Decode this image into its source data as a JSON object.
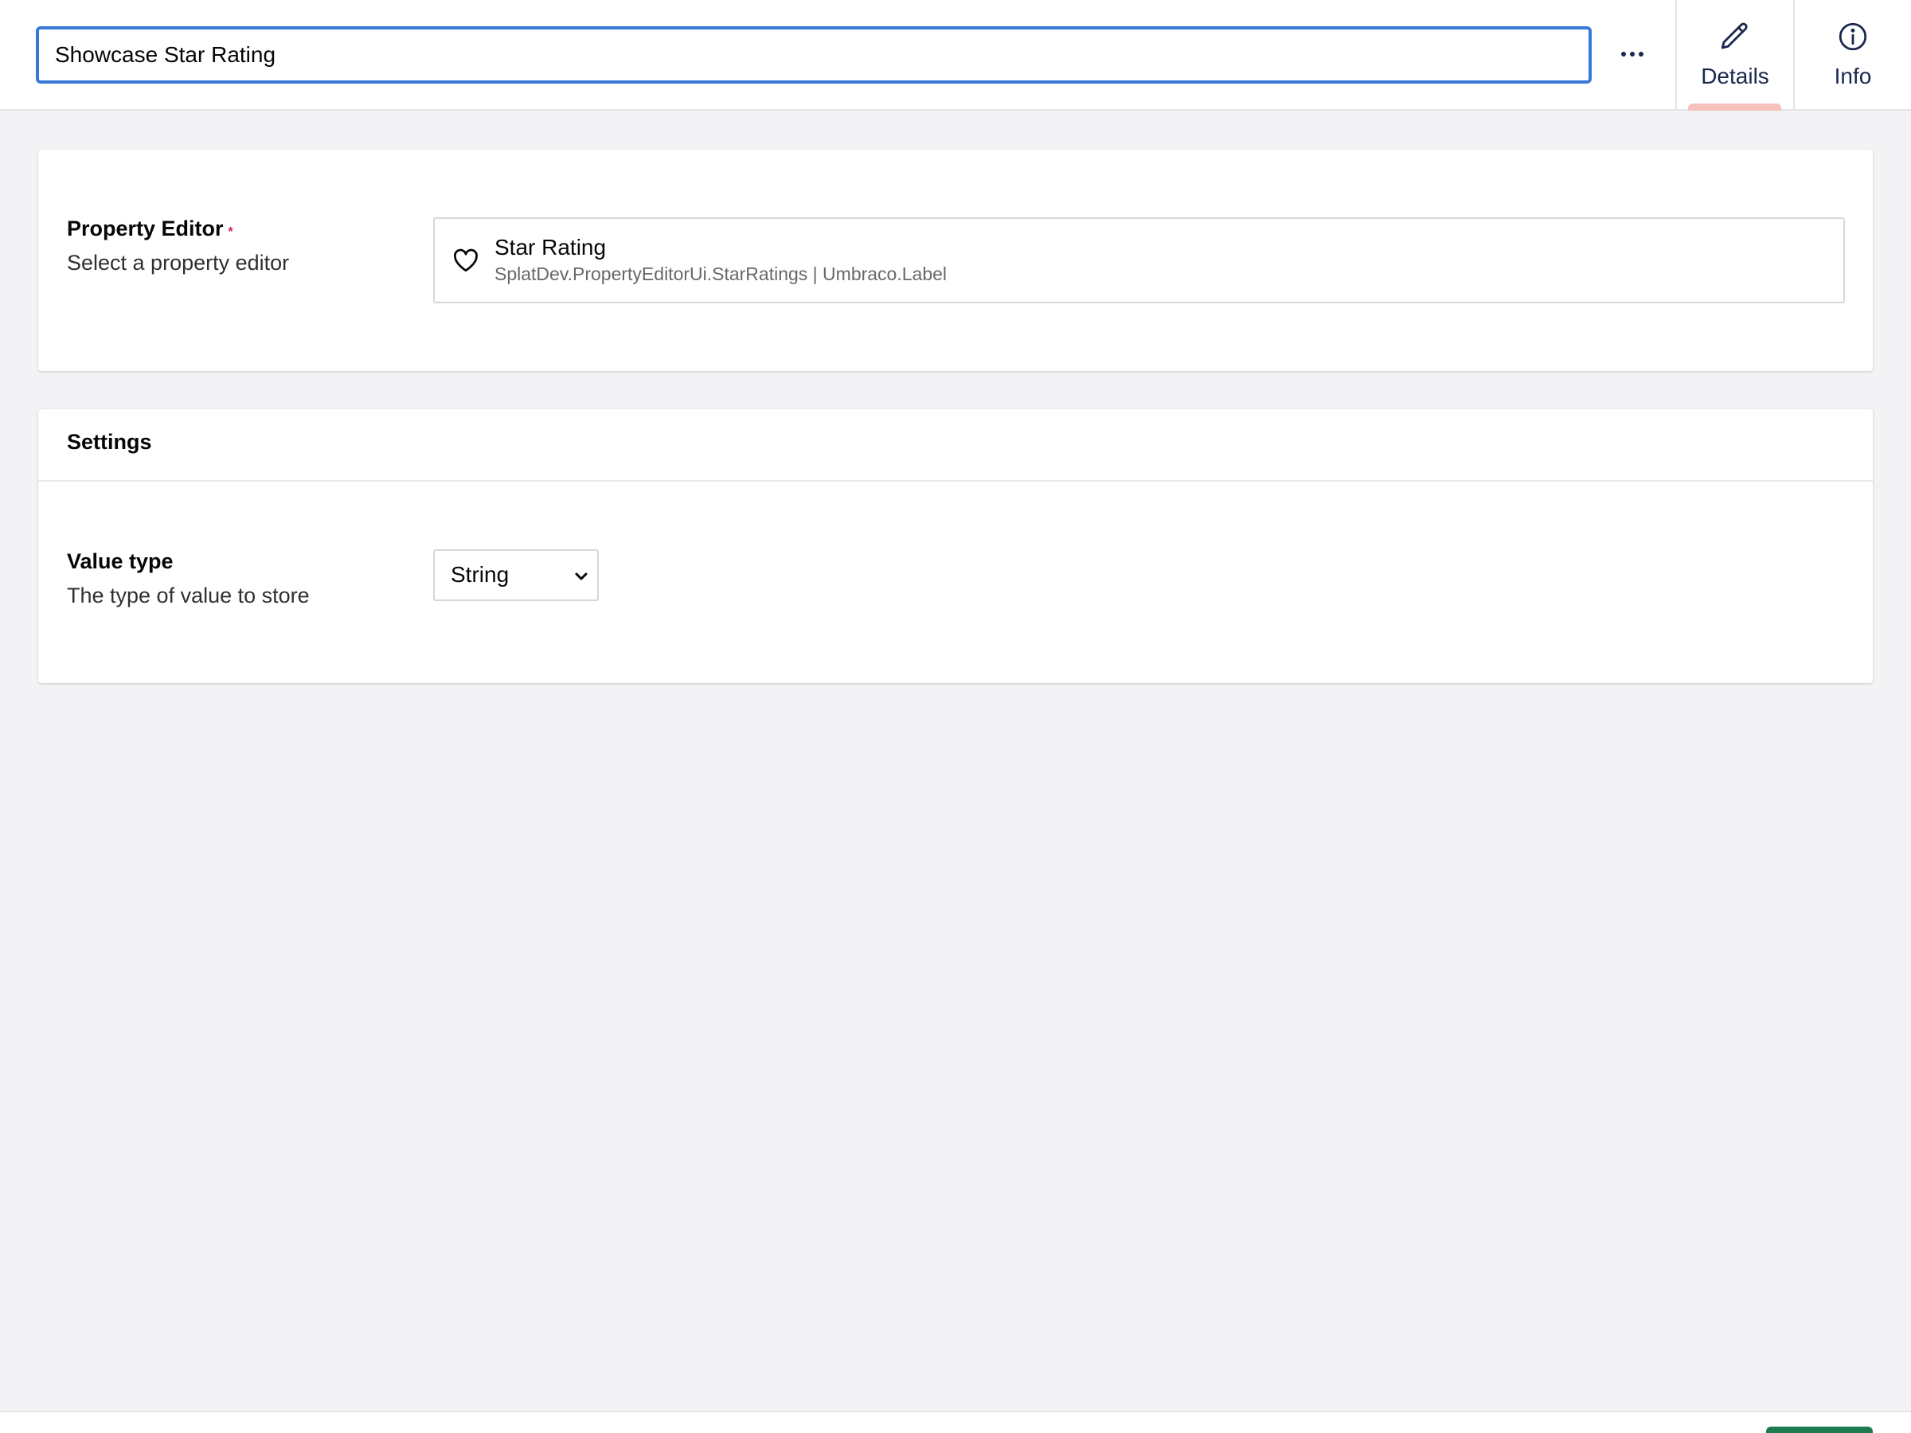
{
  "header": {
    "name_value": "Showcase Star Rating",
    "more_label": "...",
    "tabs": [
      {
        "label": "Details",
        "icon": "pencil-icon",
        "active": true
      },
      {
        "label": "Info",
        "icon": "info-icon",
        "active": false
      }
    ]
  },
  "property_editor": {
    "label": "Property Editor",
    "required_mark": "*",
    "description": "Select a property editor",
    "selected": {
      "icon": "heart-icon",
      "name": "Star Rating",
      "alias": "SplatDev.PropertyEditorUi.StarRatings | Umbraco.Label"
    }
  },
  "settings": {
    "title": "Settings",
    "value_type": {
      "label": "Value type",
      "description": "The type of value to store",
      "selected": "String"
    }
  },
  "colors": {
    "accent": "#3879d8",
    "required": "#d42054",
    "active_tab_indicator": "#f5c1bc",
    "save_button": "#1c7a4f",
    "background": "#f3f3f5"
  }
}
